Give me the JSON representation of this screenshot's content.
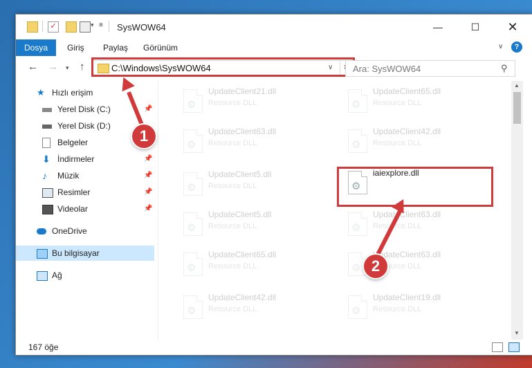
{
  "window": {
    "title": "SysWOW64"
  },
  "ribbon": {
    "tabs": [
      "Dosya",
      "Giriş",
      "Paylaş",
      "Görünüm"
    ],
    "help": "?"
  },
  "address": {
    "path": "C:\\Windows\\SysWOW64"
  },
  "search": {
    "placeholder": "Ara: SysWOW64"
  },
  "sidebar": {
    "items": [
      {
        "label": "Hızlı erişim",
        "icon": "star-icon"
      },
      {
        "label": "Yerel Disk (C:)",
        "icon": "drive-icon",
        "pinned": true
      },
      {
        "label": "Yerel Disk (D:)",
        "icon": "drive-icon",
        "pinned": false
      },
      {
        "label": "Belgeler",
        "icon": "document-icon",
        "pinned": true
      },
      {
        "label": "İndirmeler",
        "icon": "download-icon",
        "pinned": true
      },
      {
        "label": "Müzik",
        "icon": "music-icon",
        "pinned": true
      },
      {
        "label": "Resimler",
        "icon": "pictures-icon",
        "pinned": true
      },
      {
        "label": "Videolar",
        "icon": "video-icon",
        "pinned": true
      },
      {
        "label": "OneDrive",
        "icon": "cloud-icon"
      },
      {
        "label": "Bu bilgisayar",
        "icon": "computer-icon",
        "selected": true
      },
      {
        "label": "Ağ",
        "icon": "network-icon"
      }
    ]
  },
  "files": {
    "left": [
      {
        "name": "UpdateClient21.dll",
        "type": "Resource DLL"
      },
      {
        "name": "UpdateClient63.dll",
        "type": "Resource DLL"
      },
      {
        "name": "UpdateClient5.dll",
        "type": "Resource DLL"
      },
      {
        "name": "UpdateClient5.dll",
        "type": "Resource DLL"
      },
      {
        "name": "UpdateClient65.dll",
        "type": "Resource DLL"
      },
      {
        "name": "UpdateClient42.dll",
        "type": "Resource DLL"
      }
    ],
    "right": [
      {
        "name": "UpdateClient65.dll",
        "type": "Resource DLL"
      },
      {
        "name": "UpdateClient42.dll",
        "type": "Resource DLL"
      },
      {
        "name": "iaiexplore.dll",
        "type": ""
      },
      {
        "name": "UpdateClient63.dll",
        "type": "Resource DLL"
      },
      {
        "name": "UpdateClient63.dll",
        "type": "Resource DLL"
      },
      {
        "name": "UpdateClient19.dll",
        "type": "Resource DLL"
      }
    ]
  },
  "status": {
    "count": "167 öğe"
  },
  "annotations": {
    "step1": "1",
    "step2": "2"
  },
  "colors": {
    "accent": "#1979ca",
    "highlight": "#d03a3a"
  }
}
